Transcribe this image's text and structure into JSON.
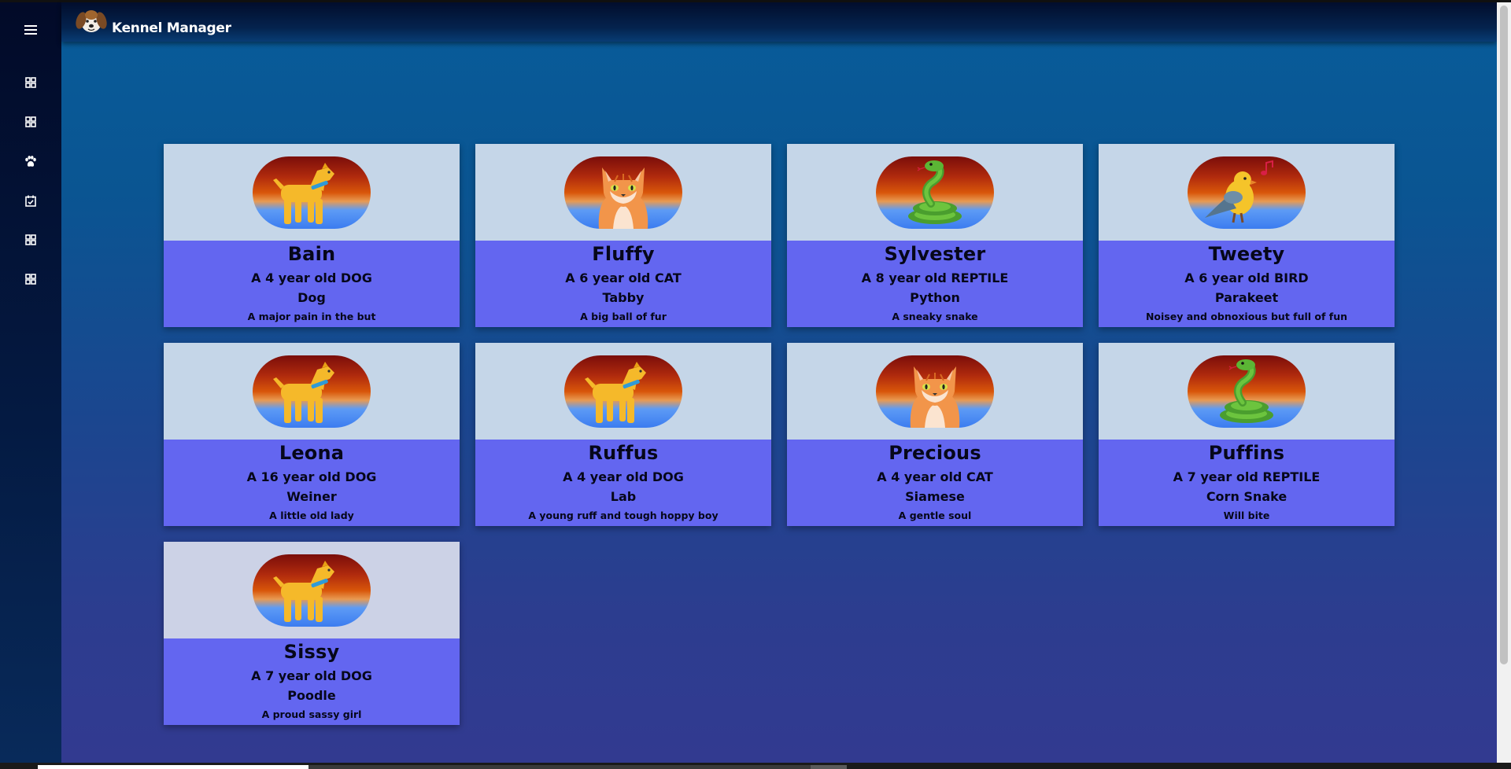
{
  "app": {
    "title": "Kennel Manager",
    "logo_icon": "dog-face-icon"
  },
  "sidebar": {
    "menu_icon": "hamburger-menu-icon",
    "items": [
      {
        "icon": "grid-icon"
      },
      {
        "icon": "grid-icon"
      },
      {
        "icon": "paw-icon"
      },
      {
        "icon": "calendar-check-icon"
      },
      {
        "icon": "grid-icon"
      },
      {
        "icon": "grid-icon"
      }
    ]
  },
  "pets": [
    {
      "name": "Bain",
      "age": "A 4 year old DOG",
      "breed": "Dog",
      "description": "A major pain in the but",
      "icon": "dog-icon"
    },
    {
      "name": "Fluffy",
      "age": "A 6 year old CAT",
      "breed": "Tabby",
      "description": "A big ball of fur",
      "icon": "cat-icon"
    },
    {
      "name": "Sylvester",
      "age": "A 8 year old REPTILE",
      "breed": "Python",
      "description": "A sneaky snake",
      "icon": "snake-icon"
    },
    {
      "name": "Tweety",
      "age": "A 6 year old BIRD",
      "breed": "Parakeet",
      "description": "Noisey and obnoxious but full of fun",
      "icon": "bird-icon"
    },
    {
      "name": "Leona",
      "age": "A 16 year old DOG",
      "breed": "Weiner",
      "description": "A little old lady",
      "icon": "dog-icon"
    },
    {
      "name": "Ruffus",
      "age": "A 4 year old DOG",
      "breed": "Lab",
      "description": "A young ruff and tough hoppy boy",
      "icon": "dog-icon"
    },
    {
      "name": "Precious",
      "age": "A 4 year old CAT",
      "breed": "Siamese",
      "description": "A gentle soul",
      "icon": "cat-icon"
    },
    {
      "name": "Puffins",
      "age": "A 7 year old REPTILE",
      "breed": "Corn Snake",
      "description": "Will bite",
      "icon": "snake-icon"
    },
    {
      "name": "Sissy",
      "age": "A 7 year old DOG",
      "breed": "Poodle",
      "description": "A proud sassy girl",
      "icon": "dog-icon"
    }
  ]
}
